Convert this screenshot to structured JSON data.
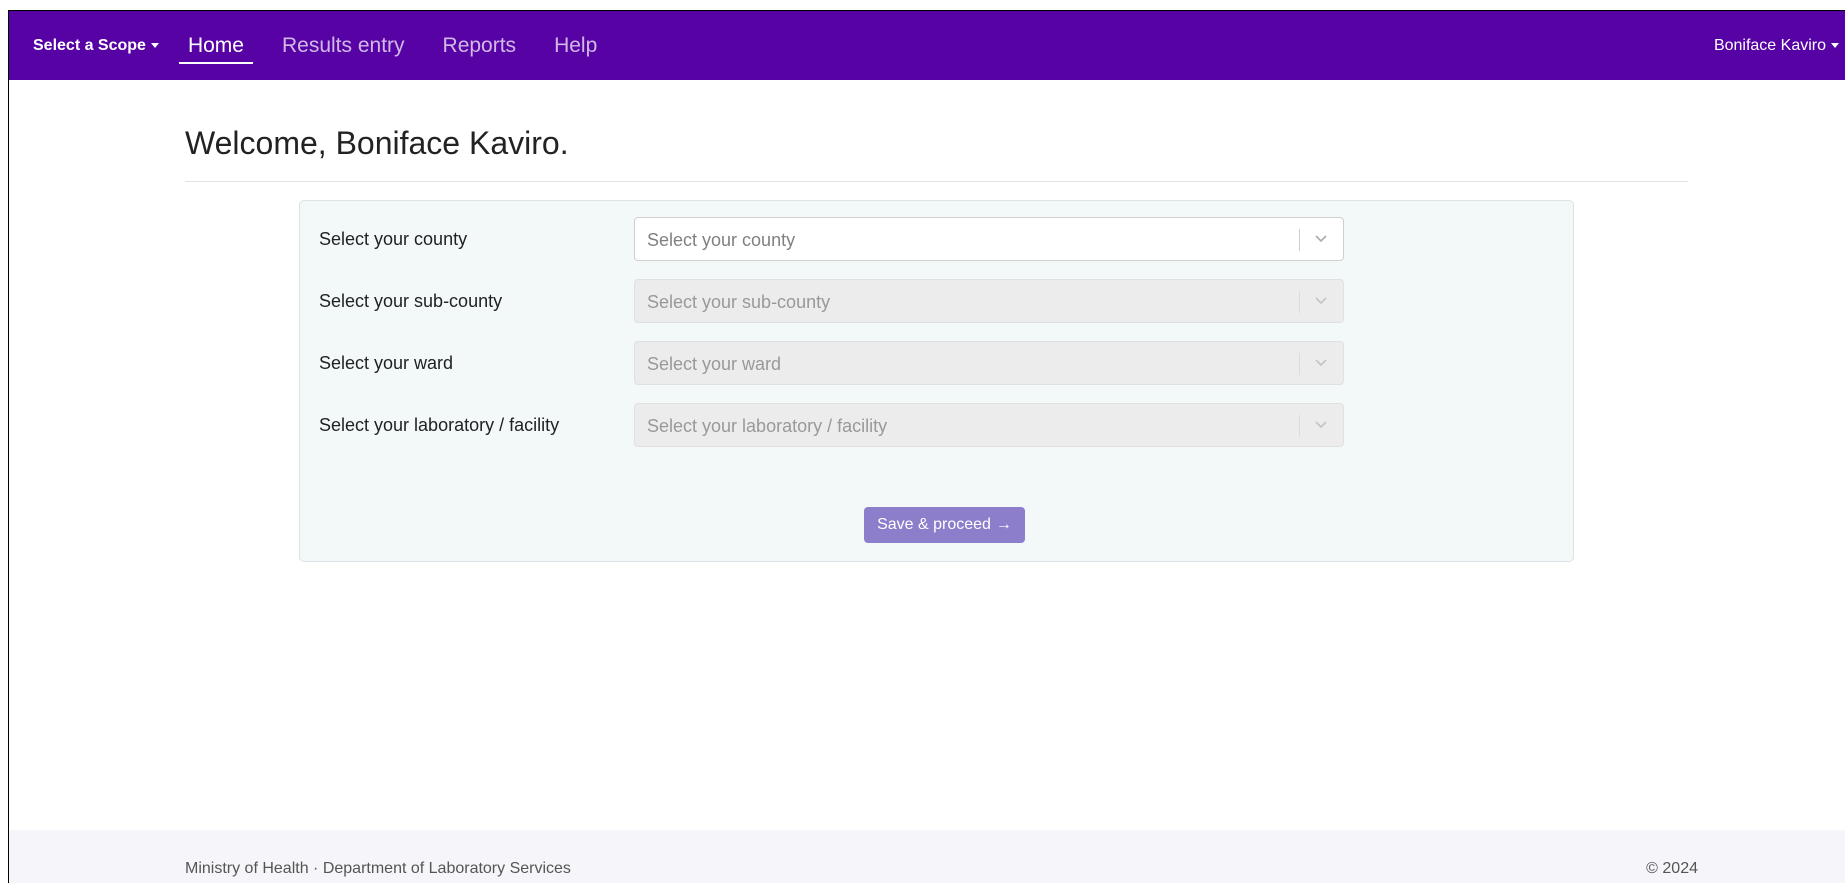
{
  "colors": {
    "brand": "#5602a4",
    "button": "#8c7ecb"
  },
  "navbar": {
    "scope_label": "Select a Scope",
    "links": [
      {
        "label": "Home",
        "active": true
      },
      {
        "label": "Results entry",
        "active": false
      },
      {
        "label": "Reports",
        "active": false
      },
      {
        "label": "Help",
        "active": false
      }
    ],
    "user_name": "Boniface Kaviro"
  },
  "main": {
    "welcome": "Welcome, Boniface Kaviro.",
    "form": {
      "fields": [
        {
          "label": "Select your county",
          "placeholder": "Select your county",
          "disabled": false
        },
        {
          "label": "Select your sub-county",
          "placeholder": "Select your sub-county",
          "disabled": true
        },
        {
          "label": "Select your ward",
          "placeholder": "Select your ward",
          "disabled": true
        },
        {
          "label": "Select your laboratory / facility",
          "placeholder": "Select your laboratory / facility",
          "disabled": true
        }
      ],
      "submit_label": "Save & proceed",
      "submit_icon": "arrow-right-icon",
      "submit_arrow": "→"
    }
  },
  "footer": {
    "left": "Ministry of Health · Department of Laboratory Services",
    "right": "© 2024"
  }
}
